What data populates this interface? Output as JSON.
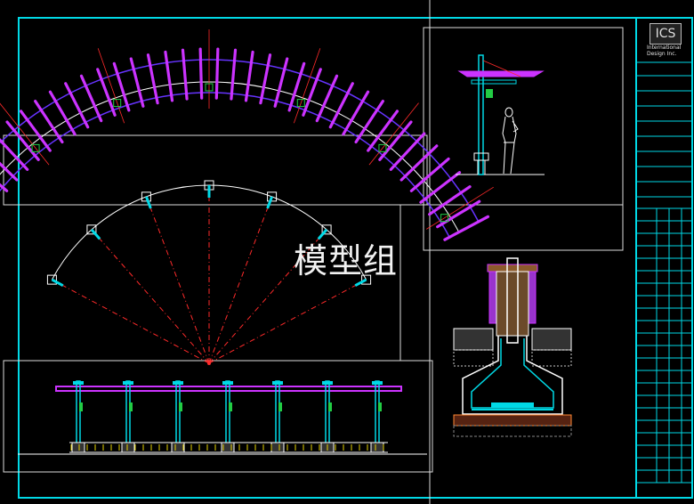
{
  "watermark": "模型组",
  "title_block": {
    "logo_mark": "ICS",
    "company_line1": "International",
    "company_line2": "Design Inc."
  },
  "colors": {
    "background": "#000000",
    "frame": "#00d9e6",
    "viewport_border": "#dddddd",
    "magenta": "#cc33ff",
    "purple": "#6633ff",
    "red": "#ff2a2a",
    "white": "#ffffff",
    "green": "#22cc44",
    "yellow": "#e6d200",
    "orange": "#ff8833",
    "brown": "#8c5a2b"
  },
  "drawings": {
    "roof_plan": {
      "rafter_count": 40
    },
    "column_plan": {
      "column_count": 7
    },
    "front_elevation": {
      "column_count": 7
    },
    "side_section": {},
    "foundation_detail": {}
  }
}
